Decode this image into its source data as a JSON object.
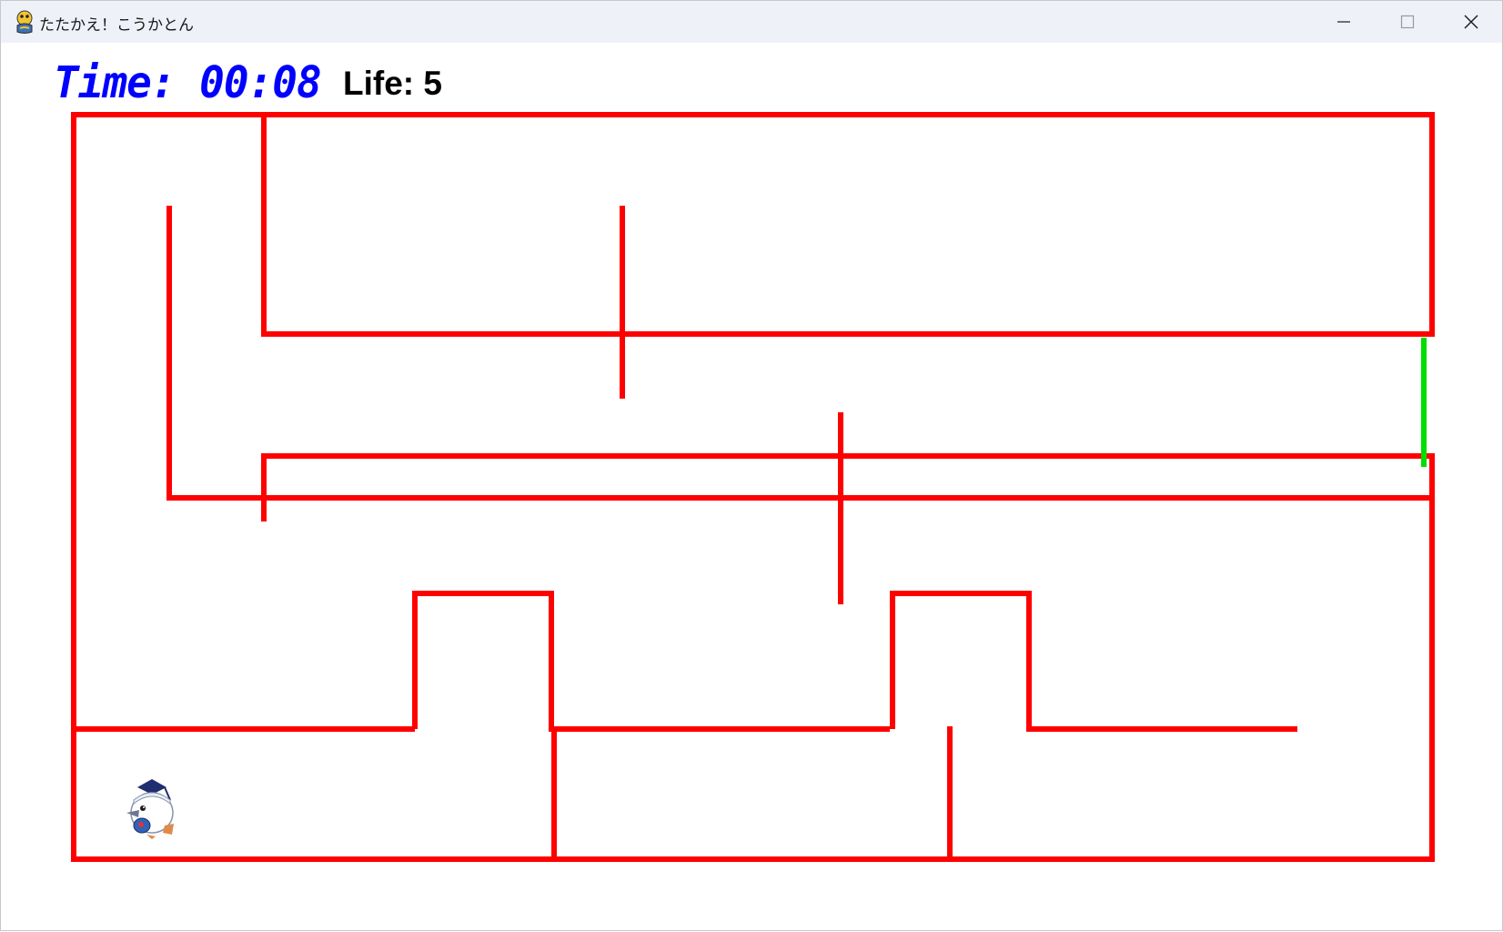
{
  "window": {
    "title": "たたかえ！こうかとん",
    "controls": {
      "minimize": "minimize",
      "maximize": "maximize",
      "close": "close"
    }
  },
  "hud": {
    "time_prefix": "Time: ",
    "time_value": "00:08",
    "life_prefix": "Life: ",
    "life_value": "5"
  },
  "maze": {
    "wall_color": "#ff0000",
    "goal_color": "#00dd00"
  },
  "player": {
    "icon": "kokaton-bird-icon"
  }
}
